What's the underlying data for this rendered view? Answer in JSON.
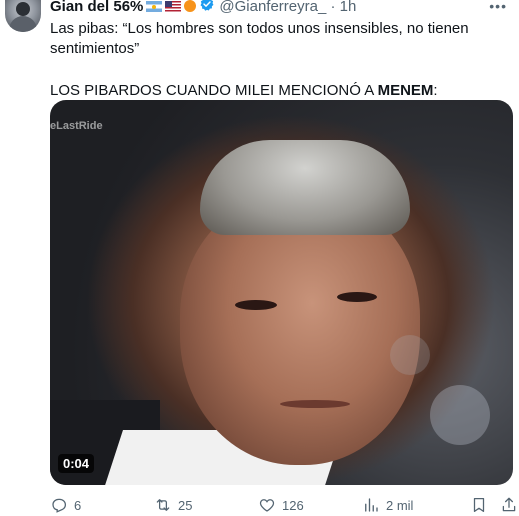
{
  "tweet": {
    "display_name": "Gian del 56%",
    "handle": "@Gianferreyra_",
    "separator": "·",
    "time": "1h",
    "text_line1": "Las pibas: “Los hombres son todos unos insensibles, no tienen sentimientos”",
    "text_line2_prefix": "LOS PIBARDOS CUANDO MILEI MENCIONÓ A ",
    "text_line2_bold": "MENEM",
    "text_line2_suffix": ":"
  },
  "media": {
    "watermark": "eLastRide",
    "duration": "0:04"
  },
  "actions": {
    "replies": "6",
    "retweets": "25",
    "likes": "126",
    "views": "2 mil"
  },
  "icons": {
    "verified": "verified-badge-icon",
    "more": "more-icon",
    "reply": "reply-icon",
    "retweet": "retweet-icon",
    "like": "heart-icon",
    "views": "views-icon",
    "bookmark": "bookmark-icon",
    "share": "share-icon"
  },
  "colors": {
    "verified": "#1d9bf0",
    "secondary_text": "#536471",
    "primary_text": "#0f1419"
  }
}
